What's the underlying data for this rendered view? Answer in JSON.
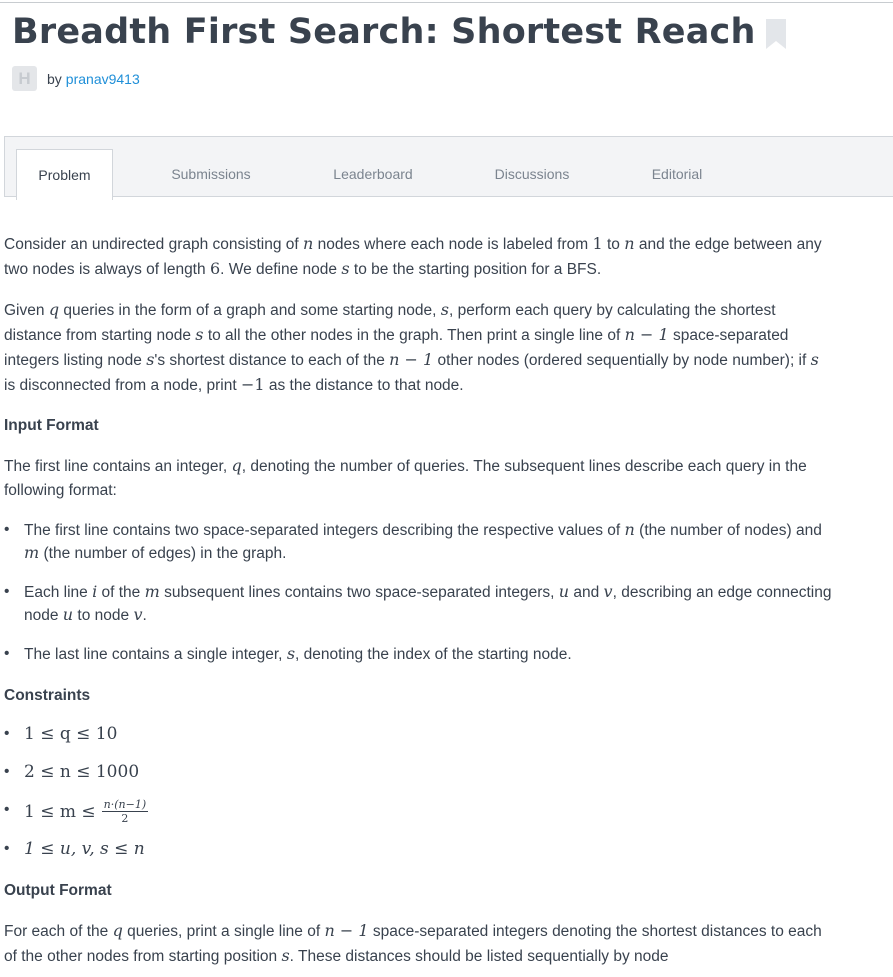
{
  "title": "Breadth First Search: Shortest Reach",
  "author_prefix": "by",
  "author": "pranav9413",
  "avatar_letter": "H",
  "tabs": [
    {
      "label": "Problem"
    },
    {
      "label": "Submissions"
    },
    {
      "label": "Leaderboard"
    },
    {
      "label": "Discussions"
    },
    {
      "label": "Editorial"
    }
  ],
  "p1": {
    "a": "Consider an undirected graph consisting of",
    "n": "n",
    "b": "nodes where each node is labeled from",
    "one": "1",
    "to": "to",
    "n2": "n",
    "c": "and the edge between any two nodes is always of length",
    "six": "6",
    "d": ". We define node",
    "s": "s",
    "e": "to be the starting position for a BFS."
  },
  "p2": {
    "a": "Given",
    "q": "q",
    "b": "queries in the form of a graph and some starting node,",
    "s1": "s",
    "c": ", perform each query by calculating the shortest distance from starting node",
    "s2": "s",
    "d": "to all the other nodes in the graph. Then print a single line of",
    "nm1": "n − 1",
    "e": "space-separated integers listing node",
    "s3": "s",
    "f": "'s shortest distance to each of the",
    "nm1b": "n − 1",
    "g": "other nodes (ordered sequentially by node number); if",
    "s4": "s",
    "h": "is disconnected from a node, print",
    "neg1": "−1",
    "i": "as the distance to that node."
  },
  "input_heading": "Input Format",
  "input_p": {
    "a": "The first line contains an integer,",
    "q": "q",
    "b": ", denoting the number of queries. The subsequent lines describe each query in the following format:"
  },
  "input_bullets": {
    "b1a": "The first line contains two space-separated integers describing the respective values of",
    "b1n": "n",
    "b1b": "(the number of nodes) and",
    "b1m": "m",
    "b1c": "(the number of edges) in the graph.",
    "b2a": "Each line",
    "b2i": "i",
    "b2b": "of the",
    "b2m": "m",
    "b2c": "subsequent lines contains two space-separated integers,",
    "b2u": "u",
    "b2d": "and",
    "b2v": "v",
    "b2e": ", describing an edge connecting node",
    "b2u2": "u",
    "b2f": "to node",
    "b2v2": "v",
    "b2g": ".",
    "b3a": "The last line contains a single integer,",
    "b3s": "s",
    "b3b": ", denoting the index of the starting node."
  },
  "constraints_heading": "Constraints",
  "constraints": {
    "c1": "1 ≤ q ≤ 10",
    "c2": "2 ≤ n ≤ 1000",
    "c3": "1 ≤ m ≤",
    "c3num": "n·(n−1)",
    "c3den": "2",
    "c4": "1 ≤ u, v, s ≤ n"
  },
  "output_heading": "Output Format",
  "output_p": {
    "a": "For each of the",
    "q": "q",
    "b": "queries, print a single line of",
    "nm1": "n − 1",
    "c": "space-separated integers denoting the shortest distances to each of the other nodes from starting position",
    "s": "s",
    "d": ". These distances should be listed sequentially by node"
  }
}
